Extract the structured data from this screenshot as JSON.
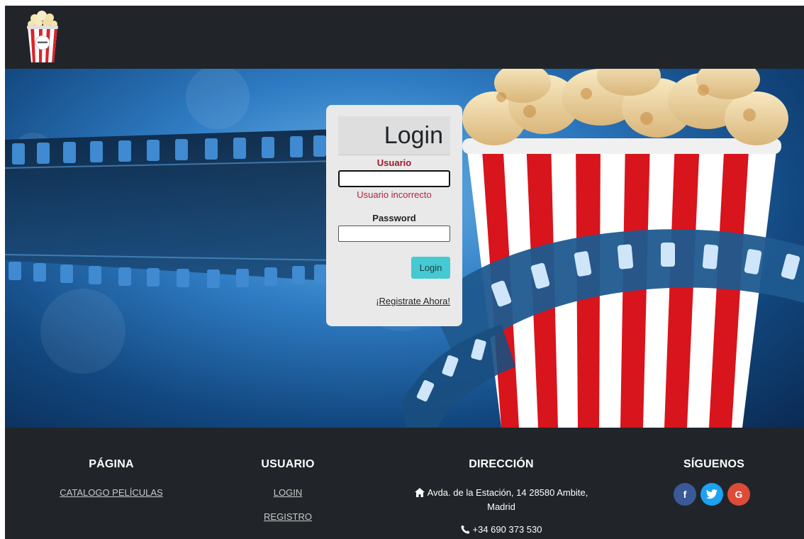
{
  "header": {
    "logo_icon": "popcorn-bucket-logo"
  },
  "login": {
    "title": "Login",
    "usuario_label": "Usuario",
    "usuario_value": "",
    "usuario_error": "Usuario incorrecto",
    "password_label": "Password",
    "password_value": "",
    "button_label": "Login",
    "register_link": "¡Registrate Ahora!"
  },
  "footer": {
    "pagina": {
      "heading": "PÁGINA",
      "links": [
        "CATALOGO PELÍCULAS"
      ]
    },
    "usuario": {
      "heading": "USUARIO",
      "links": [
        "LOGIN",
        "REGISTRO"
      ]
    },
    "direccion": {
      "heading": "DIRECCIÓN",
      "address_line1": "Avda. de la Estación, 14 28580 Ambite,",
      "address_line2": "Madrid",
      "phone": "+34 690 373 530",
      "address_icon": "home-icon",
      "phone_icon": "phone-icon"
    },
    "siguenos": {
      "heading": "SÍGUENOS",
      "social": [
        {
          "icon": "facebook-icon",
          "glyph": "f",
          "color": "#3b5998"
        },
        {
          "icon": "twitter-icon",
          "glyph": "",
          "color": "#1da1f2"
        },
        {
          "icon": "google-plus-icon",
          "glyph": "G",
          "color": "#dd4b39"
        }
      ]
    }
  },
  "colors": {
    "dark": "#212529",
    "accent": "#45c9d3",
    "error": "#b3243a"
  }
}
